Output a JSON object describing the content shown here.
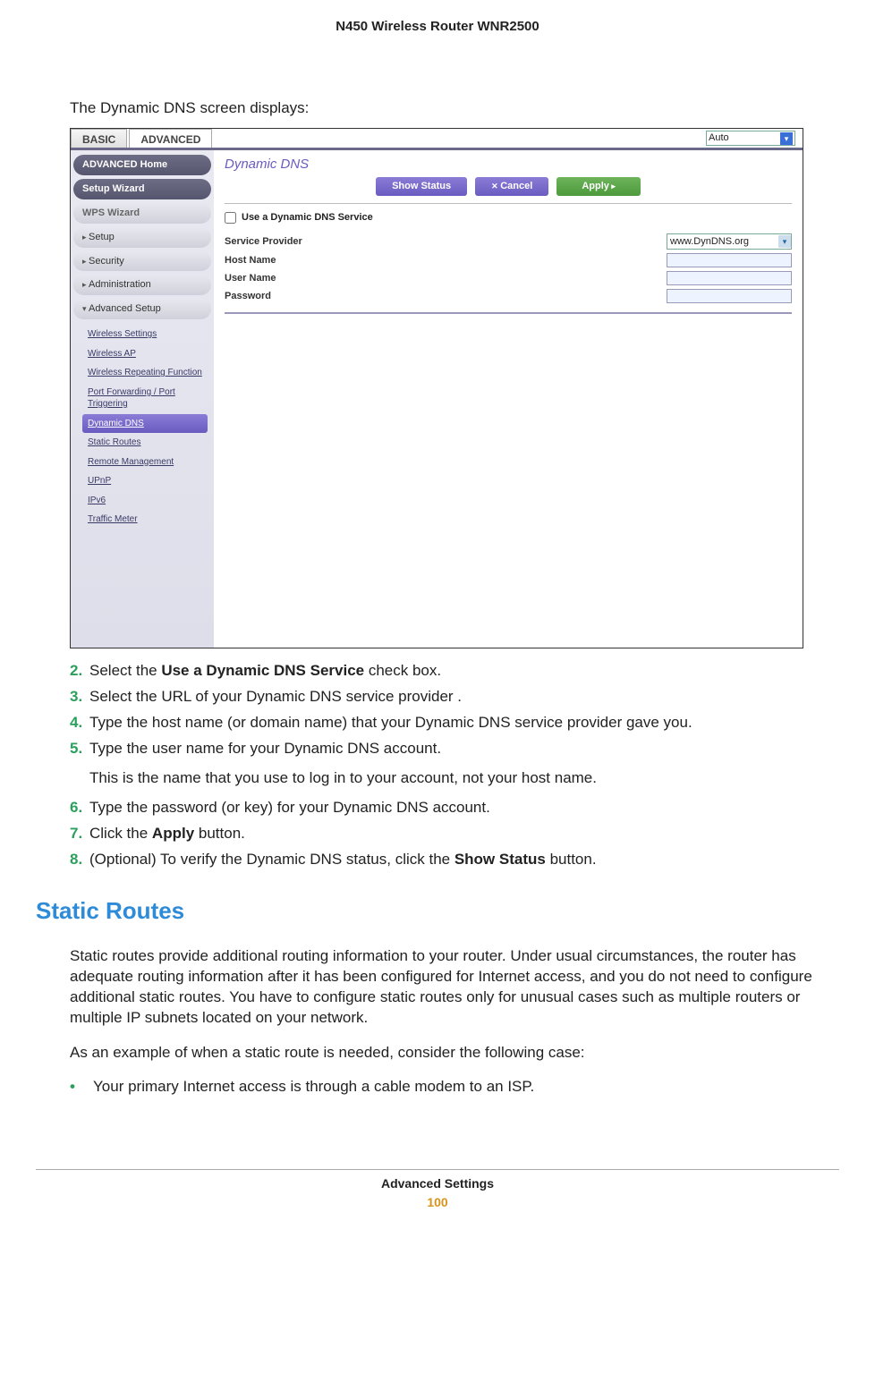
{
  "header": {
    "title": "N450 Wireless Router WNR2500"
  },
  "intro": "The Dynamic DNS screen displays:",
  "shot": {
    "tabs": {
      "basic": "BASIC",
      "advanced": "ADVANCED"
    },
    "autoSelect": "Auto",
    "sidebar": {
      "advHome": "ADVANCED Home",
      "setupWizard": "Setup Wizard",
      "wpsWizard": "WPS Wizard",
      "setup": "Setup",
      "security": "Security",
      "administration": "Administration",
      "advSetup": "Advanced Setup",
      "sub": {
        "wireless": "Wireless Settings",
        "wirelessAp": "Wireless AP",
        "repeat": "Wireless Repeating Function",
        "portfw": "Port Forwarding / Port Triggering",
        "ddns": "Dynamic DNS",
        "static": "Static Routes",
        "remote": "Remote Management",
        "upnp": "UPnP",
        "ipv6": "IPv6",
        "traffic": "Traffic Meter"
      }
    },
    "content": {
      "title": "Dynamic DNS",
      "btnStatus": "Show Status",
      "btnCancel": "Cancel",
      "btnApply": "Apply",
      "chk": "Use a Dynamic DNS Service",
      "provider": {
        "label": "Service Provider",
        "value": "www.DynDNS.org"
      },
      "host": "Host Name",
      "user": "User Name",
      "pass": "Password"
    }
  },
  "steps": {
    "s2": {
      "num": "2.",
      "text_pre": "Select the ",
      "bold": "Use a Dynamic DNS Service",
      "text_post": " check box."
    },
    "s3": {
      "num": "3.",
      "text": "Select the URL of your Dynamic DNS service provider ."
    },
    "s4": {
      "num": "4.",
      "text": "Type the host name (or domain name) that your Dynamic DNS service provider gave you."
    },
    "s5": {
      "num": "5.",
      "text": "Type the user name for your Dynamic DNS account.",
      "sub": "This is the name that you use to log in to your account, not your host name."
    },
    "s6": {
      "num": "6.",
      "text": "Type the password (or key) for your Dynamic DNS account."
    },
    "s7": {
      "num": "7.",
      "text_pre": "Click the ",
      "bold": "Apply",
      "text_post": " button."
    },
    "s8": {
      "num": "8.",
      "text_pre": "(Optional) To verify the Dynamic DNS status, click the  ",
      "bold": "Show Status",
      "text_post": " button."
    }
  },
  "section": {
    "heading": "Static Routes",
    "p1": "Static routes provide additional routing information to your router. Under usual circumstances, the router has adequate routing information after it has been configured for Internet access, and you do not need to configure additional static routes. You have to configure static routes only for unusual cases such as multiple routers or multiple IP subnets located on your network.",
    "p2": "As an example of when a static route is needed, consider the following case:",
    "b1": "Your primary Internet access is through a cable modem to an ISP."
  },
  "footer": {
    "section": "Advanced Settings",
    "page": "100"
  }
}
